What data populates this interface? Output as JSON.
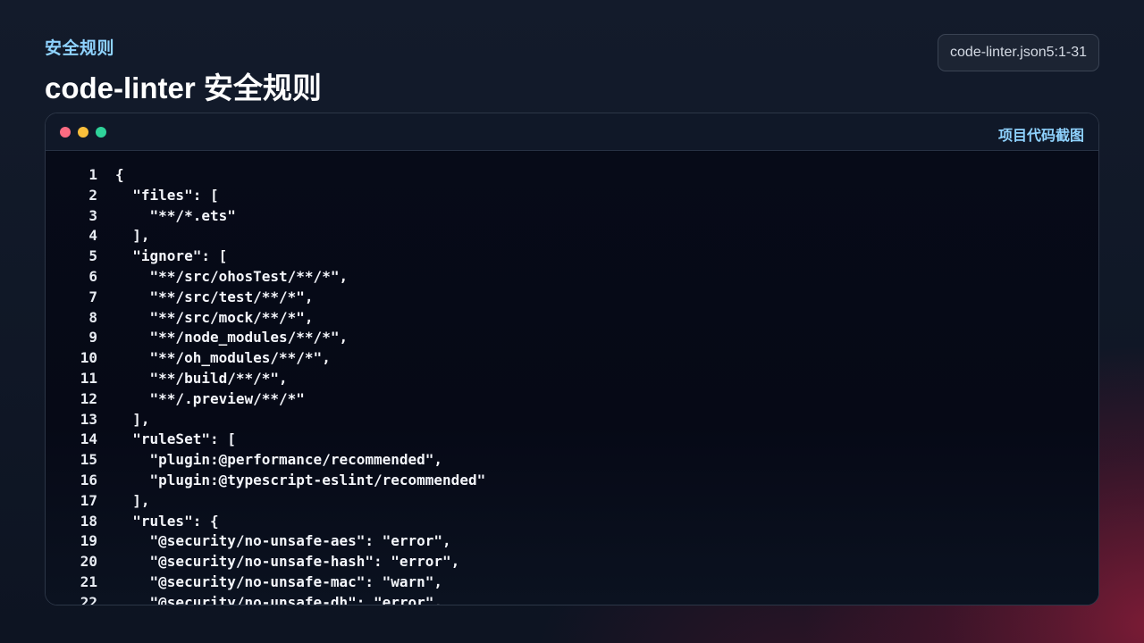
{
  "header": {
    "kicker": "安全规则",
    "title": "code-linter 安全规则",
    "file_badge": "code-linter.json5:1-31"
  },
  "window": {
    "label": "项目代码截图",
    "dots": [
      "#fb6b82",
      "#f9bf3b",
      "#2fd39a"
    ]
  },
  "code": {
    "lines": [
      {
        "n": "1",
        "text": "{"
      },
      {
        "n": "2",
        "text": "  \"files\": ["
      },
      {
        "n": "3",
        "text": "    \"**/*.ets\""
      },
      {
        "n": "4",
        "text": "  ],"
      },
      {
        "n": "5",
        "text": "  \"ignore\": ["
      },
      {
        "n": "6",
        "text": "    \"**/src/ohosTest/**/*\","
      },
      {
        "n": "7",
        "text": "    \"**/src/test/**/*\","
      },
      {
        "n": "8",
        "text": "    \"**/src/mock/**/*\","
      },
      {
        "n": "9",
        "text": "    \"**/node_modules/**/*\","
      },
      {
        "n": "10",
        "text": "    \"**/oh_modules/**/*\","
      },
      {
        "n": "11",
        "text": "    \"**/build/**/*\","
      },
      {
        "n": "12",
        "text": "    \"**/.preview/**/*\""
      },
      {
        "n": "13",
        "text": "  ],"
      },
      {
        "n": "14",
        "text": "  \"ruleSet\": ["
      },
      {
        "n": "15",
        "text": "    \"plugin:@performance/recommended\","
      },
      {
        "n": "16",
        "text": "    \"plugin:@typescript-eslint/recommended\""
      },
      {
        "n": "17",
        "text": "  ],"
      },
      {
        "n": "18",
        "text": "  \"rules\": {"
      },
      {
        "n": "19",
        "text": "    \"@security/no-unsafe-aes\": \"error\","
      },
      {
        "n": "20",
        "text": "    \"@security/no-unsafe-hash\": \"error\","
      },
      {
        "n": "21",
        "text": "    \"@security/no-unsafe-mac\": \"warn\","
      },
      {
        "n": "22",
        "text": "    \"@security/no-unsafe-dh\": \"error\","
      }
    ]
  }
}
